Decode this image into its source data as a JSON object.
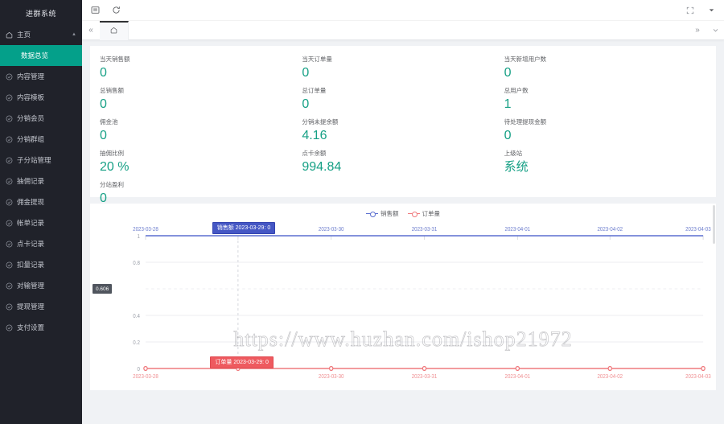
{
  "sidebar": {
    "brand": "进群系统",
    "home": {
      "label": "主页",
      "icon": "home-icon"
    },
    "active_sub": "数据总览",
    "items": [
      {
        "label": "内容管理",
        "icon": "circle-check-icon"
      },
      {
        "label": "内容模板",
        "icon": "circle-check-icon"
      },
      {
        "label": "分销会员",
        "icon": "circle-check-icon"
      },
      {
        "label": "分销群组",
        "icon": "circle-check-icon"
      },
      {
        "label": "子分站管理",
        "icon": "circle-check-icon"
      },
      {
        "label": "抽佣记录",
        "icon": "circle-check-icon"
      },
      {
        "label": "佣金提现",
        "icon": "circle-check-icon"
      },
      {
        "label": "帐单记录",
        "icon": "circle-check-icon"
      },
      {
        "label": "点卡记录",
        "icon": "circle-check-icon"
      },
      {
        "label": "扣量记录",
        "icon": "circle-check-icon"
      },
      {
        "label": "对输管理",
        "icon": "circle-check-icon"
      },
      {
        "label": "提现管理",
        "icon": "circle-check-icon"
      },
      {
        "label": "支付设置",
        "icon": "circle-check-icon"
      }
    ]
  },
  "topbar": {
    "menu_icon": "list-menu-icon",
    "refresh_icon": "refresh-icon",
    "fullscreen_icon": "fullscreen-icon",
    "user_caret_icon": "caret-down-icon"
  },
  "tabbar": {
    "prev_icon": "double-chevron-left-icon",
    "next_icon": "double-chevron-right-icon",
    "more_icon": "chevron-down-icon",
    "tabs": [
      {
        "label": "",
        "icon": "home-icon",
        "active": true
      }
    ]
  },
  "stats": {
    "columns": [
      [
        {
          "label": "当天销售额",
          "value": "0"
        },
        {
          "label": "总销售额",
          "value": "0"
        },
        {
          "label": "佣金池",
          "value": "0"
        },
        {
          "label": "抽佣比例",
          "value": "20 %"
        },
        {
          "label": "分站盈利",
          "value": "0"
        }
      ],
      [
        {
          "label": "当天订单量",
          "value": "0"
        },
        {
          "label": "总订单量",
          "value": "0"
        },
        {
          "label": "分销未提余额",
          "value": "4.16"
        },
        {
          "label": "点卡余额",
          "value": "994.84"
        }
      ],
      [
        {
          "label": "当天新增用户数",
          "value": "0"
        },
        {
          "label": "总用户数",
          "value": "1"
        },
        {
          "label": "待处理提现金额",
          "value": "0"
        },
        {
          "label": "上级站",
          "value": "系统"
        }
      ]
    ],
    "accent_color": "#16a085"
  },
  "chart_data": {
    "type": "line",
    "title": "",
    "legend": [
      {
        "name": "销售额",
        "color": "#5b6fd0"
      },
      {
        "name": "订单量",
        "color": "#ef7a7e"
      }
    ],
    "legend_position": "top-center",
    "x": [
      "2023-03-28",
      "2023-03-29",
      "2023-03-30",
      "2023-03-31",
      "2023-04-01",
      "2023-04-02",
      "2023-04-03"
    ],
    "xlabel": "",
    "ylabel": "",
    "ylim": [
      0,
      1
    ],
    "yticks": [
      "0",
      "0.2",
      "0.4",
      "0.6",
      "0.8",
      "1"
    ],
    "grid": true,
    "series": [
      {
        "name": "销售额",
        "color": "#5b6fd0",
        "values": [
          1,
          1,
          1,
          1,
          1,
          1,
          1
        ]
      },
      {
        "name": "订单量",
        "color": "#ef7a7e",
        "values": [
          0,
          0,
          0,
          0,
          0,
          0,
          0
        ]
      }
    ],
    "tooltips": {
      "sales": "销售额  2023-03-29:  0",
      "orders": "订单量  2023-03-29:  0",
      "axis": "0.606"
    },
    "hover_x": "2023-03-29"
  },
  "watermark": {
    "text": "https://www.huzhan.com/ishop21972"
  }
}
